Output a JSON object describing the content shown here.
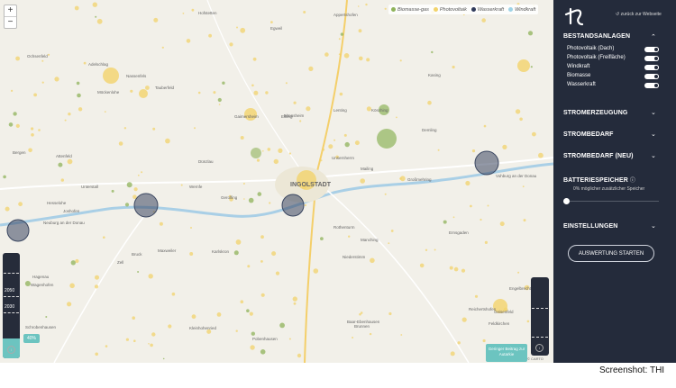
{
  "map": {
    "zoom_in": "+",
    "zoom_out": "−",
    "legend": [
      {
        "label": "Biomasse-gas",
        "color": "#8fb35a"
      },
      {
        "label": "Photovoltaik",
        "color": "#f2d36b"
      },
      {
        "label": "Wasserkraft",
        "color": "#2f3a5a"
      },
      {
        "label": "Windkraft",
        "color": "#9fd3e6"
      }
    ],
    "places": [
      "Hofstetten",
      "Appertshofen",
      "Egweil",
      "Ochsenfeld",
      "Adelschlag",
      "Nassenfels",
      "Möckenlohe",
      "Tauberfeld",
      "Gaimersheim",
      "Eitensheim",
      "Eitting",
      "Lenting",
      "Kösching",
      "Kasing",
      "Demling",
      "Bergen",
      "Attenfeld",
      "Dünzlau",
      "Unsernherrn",
      "Mailing",
      "Großmehring",
      "Vohburg an der Donau",
      "Unterstall",
      "Wernfe",
      "Gerolfing",
      "INGOLSTADT",
      "Hesselohe",
      "Joshofen",
      "Neuburg an der Donau",
      "Ernsgaden",
      "Rothenturm",
      "Zell",
      "Bruck",
      "Maxweiler",
      "Karlskron",
      "Manching",
      "Niederstimm",
      "Wagenhofen",
      "Hagenau",
      "Kleinhohenried",
      "Pobenhausen",
      "Schrobenhausen",
      "Brunnen",
      "Baar-Ebenhausen",
      "Reichertshofen",
      "Geisenfeld",
      "Engelbrechtsmünster",
      "Feldkirchen"
    ],
    "percent_badge": "40%",
    "slider_labels": [
      "2050",
      "2030"
    ],
    "min_button": "Geringer Beitrag zur Autarkie",
    "attribution": "© CARTO"
  },
  "panel": {
    "back_link": "zurück zur Webseite",
    "bestandsanlagen": {
      "title": "BESTANDSANLAGEN",
      "items": [
        {
          "label": "Photovoltaik (Dach)",
          "on": true
        },
        {
          "label": "Photovoltaik (Freifläche)",
          "on": true
        },
        {
          "label": "Windkraft",
          "on": true
        },
        {
          "label": "Biomasse",
          "on": true
        },
        {
          "label": "Wasserkraft",
          "on": true
        }
      ]
    },
    "sections": [
      "STROMERZEUGUNG",
      "STROMBEDARF",
      "STROMBEDARF (NEU)"
    ],
    "battery": {
      "title": "BATTERIESPEICHER",
      "subtitle": "0% möglicher zusätzlicher Speicher",
      "value": 0
    },
    "settings": "EINSTELLUNGEN",
    "start_button": "AUSWERTUNG STARTEN"
  },
  "credit": "Screenshot: THI"
}
